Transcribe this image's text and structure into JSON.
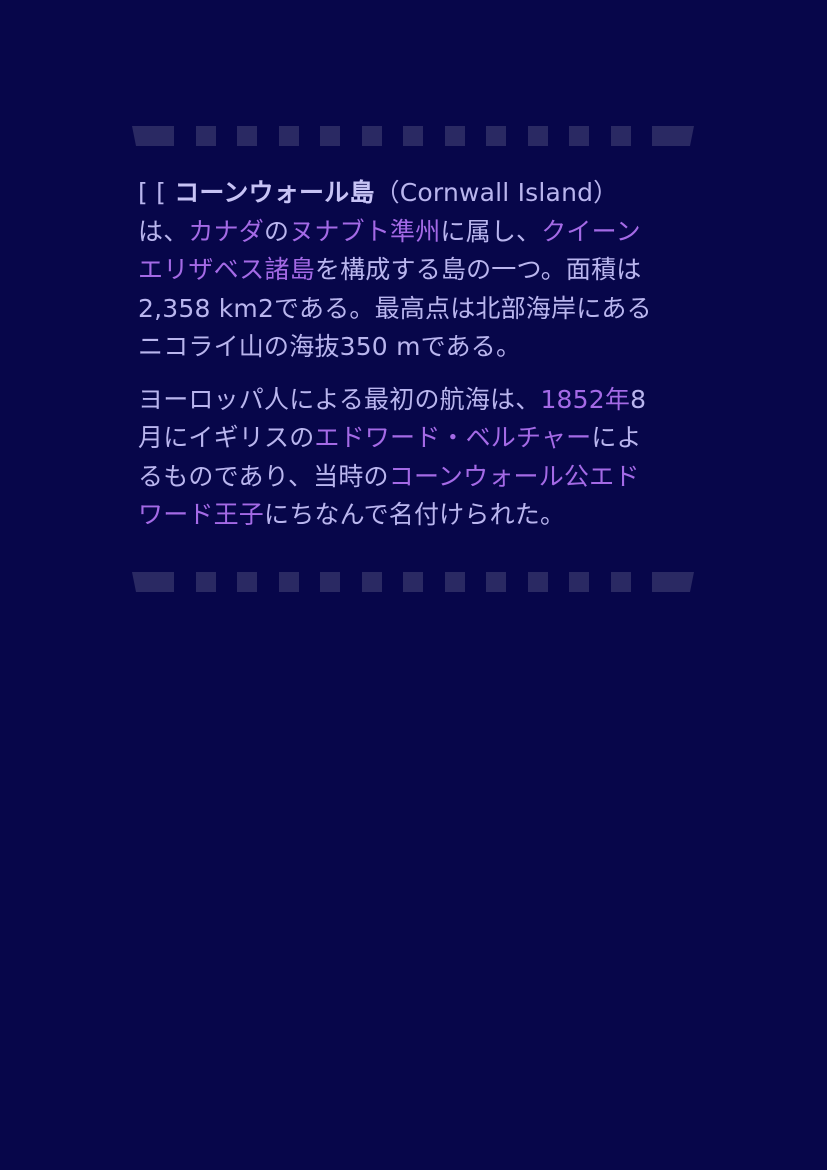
{
  "article": {
    "p1": {
      "l1": {
        "prefix": "[ [ ",
        "title": "コーンウォール島",
        "title_en": "（Cornwall Island）"
      },
      "l2": {
        "t1": "は、",
        "link_canada": "カナダ",
        "t2": "の",
        "link_nunavut": "ヌナブト準州",
        "t3": "に属し、",
        "link_queen_1": "クイーン"
      },
      "l3": {
        "link_queen_2": "エリザベス諸島",
        "t1": "を構成する島の一つ。面積は"
      },
      "l4": {
        "t1": "2,358 km2である。最高点は北部海岸にある"
      },
      "l5": {
        "t1": "ニコライ山の海抜350 mである。"
      }
    },
    "p2": {
      "l1": {
        "t1": "ヨーロッパ人による最初の航海は、",
        "link_1852": "1852年",
        "t2": "8"
      },
      "l2": {
        "t1": "月にイギリスの",
        "link_belcher": "エドワード・ベルチャー",
        "t2": "によ"
      },
      "l3": {
        "t1": "るものであり、当時の",
        "link_duke_1": "コーンウォール公エド"
      },
      "l4": {
        "link_duke_2": "ワード王子",
        "t1": "にちなんで名付けられた。"
      }
    }
  },
  "colors": {
    "background": "#07064a",
    "text": "#b9b5ee",
    "link": "#a46ae6",
    "divider": "#2a2963"
  }
}
